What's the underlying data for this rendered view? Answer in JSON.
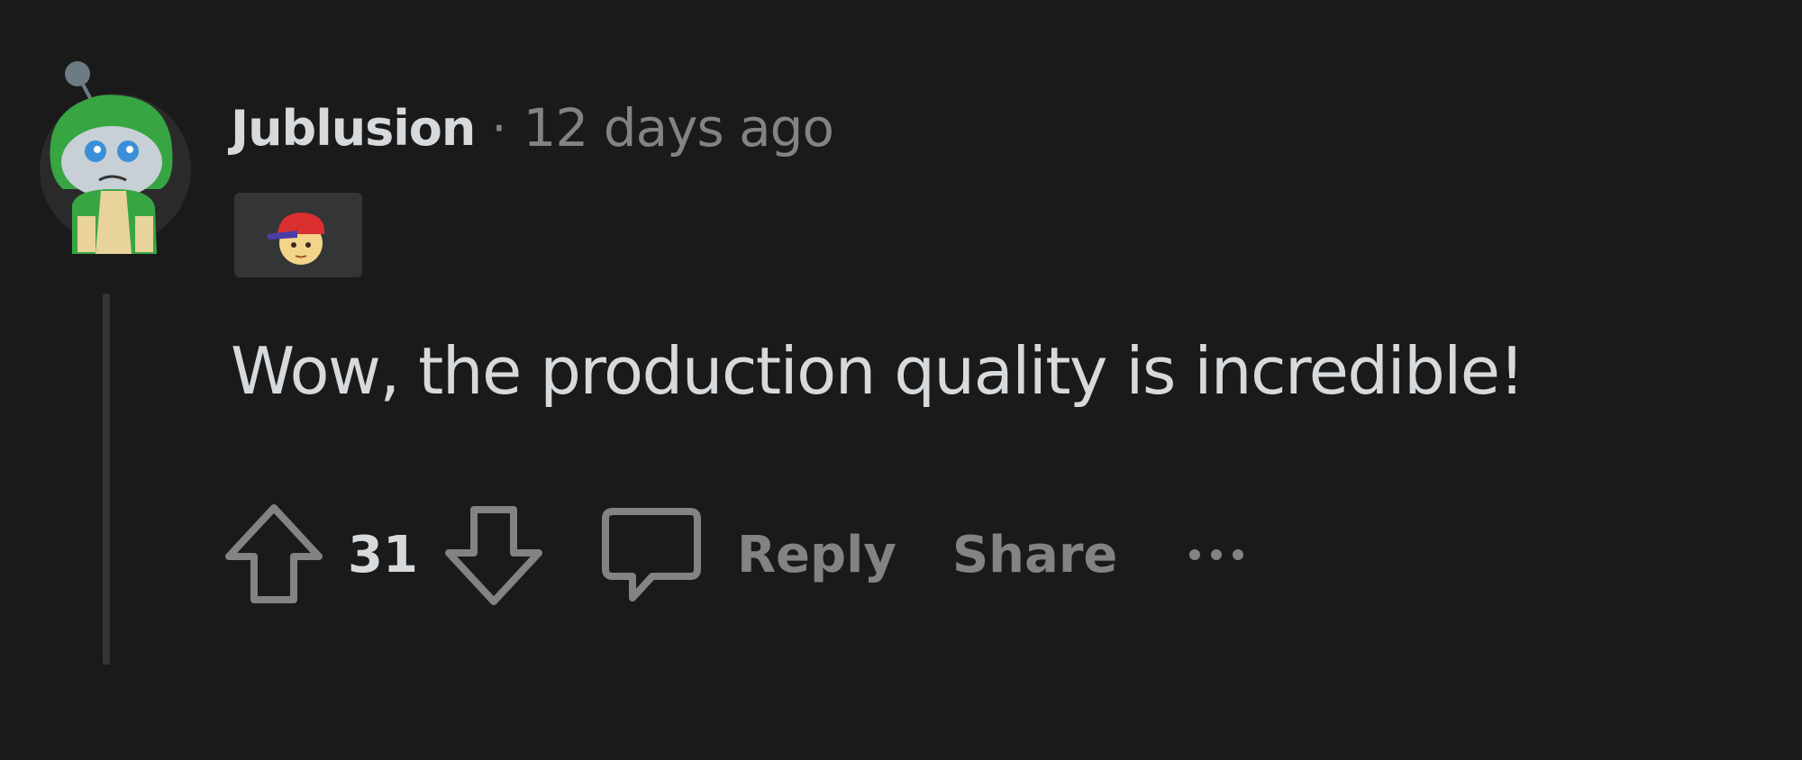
{
  "comment": {
    "author": "Jublusion",
    "separator": "·",
    "timestamp": "12 days ago",
    "body": "Wow, the production quality is incredible!",
    "score": "31",
    "reply_label": "Reply",
    "share_label": "Share",
    "more_icon": "ellipsis-icon",
    "avatar_icon": "snoo-avatar-icon",
    "flair_icon": "ness-flair-icon"
  },
  "colors": {
    "background": "#1a1a1b",
    "text_primary": "#d7dadc",
    "text_secondary": "#818384",
    "thread_line": "#343536"
  }
}
